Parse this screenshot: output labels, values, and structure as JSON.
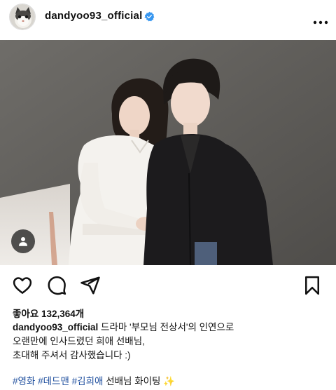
{
  "post": {
    "username": "dandyoo93_official",
    "verified_icon": "verified-badge-icon",
    "more_icon": "more-options-icon",
    "likes_text": "좋아요 132,364개",
    "caption_body_1": " 드라마 '부모님 전상서'의 인연으로",
    "caption_line_2": "오랜만에 인사드렸던 희애 선배님,",
    "caption_line_3": "초대해 주셔서 감사했습니다 :)",
    "hashtags": [
      "#영화",
      "#데드맨",
      "#김희애"
    ],
    "caption_tail": " 선배님 화이팅 ✨",
    "icons": {
      "like": "heart-icon",
      "comment": "comment-icon",
      "share": "send-icon",
      "save": "bookmark-icon",
      "tags": "tagged-people-icon"
    }
  },
  "colors": {
    "verified": "#3897f0",
    "hashtag": "#1f4f9e",
    "photo_bg": "#5d5b58"
  }
}
